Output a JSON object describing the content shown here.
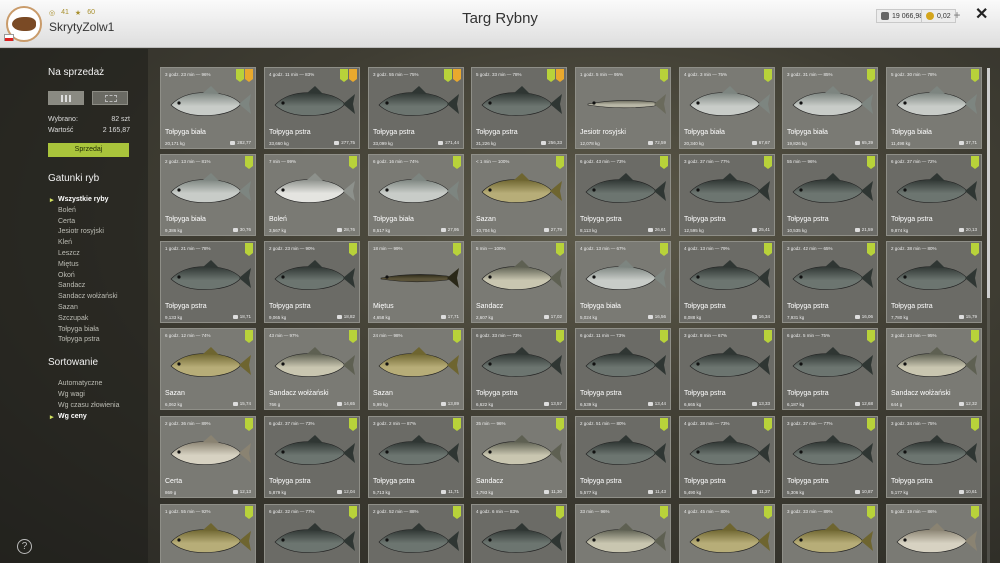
{
  "header": {
    "title": "Targ Rybny",
    "username": "SkrytyZolw1",
    "stat_a": "41",
    "stat_b": "60",
    "silver": "19 066,98",
    "gold": "0,02",
    "plus": "+",
    "close": "✕"
  },
  "sidebar": {
    "for_sale": "Na sprzedaż",
    "selected_label": "Wybrano:",
    "selected_value": "82 szt",
    "value_label": "Wartość",
    "value_value": "2 165,87",
    "sell": "Sprzedaj",
    "species_title": "Gatunki ryb",
    "species": [
      "Wszystkie ryby",
      "Boleń",
      "Certa",
      "Jesiotr rosyjski",
      "Kleń",
      "Leszcz",
      "Miętus",
      "Okoń",
      "Sandacz",
      "Sandacz wołżański",
      "Sazan",
      "Szczupak",
      "Tołpyga biała",
      "Tołpyga pstra"
    ],
    "sort_title": "Sortowanie",
    "sort": [
      "Automatyczne",
      "Wg wagi",
      "Wg czasu złowienia",
      "Wg ceny"
    ],
    "help": "?"
  },
  "colors": {
    "accent": "#a9c43b",
    "badge_green": "#b8d23a",
    "badge_orange": "#e9a92d",
    "gold": "#d4a51c"
  },
  "cards": [
    {
      "time": "3 godz. 23 min — 96%",
      "name": "Tołpyga biała",
      "weight": "20,171 kg",
      "price": "282,77",
      "badges": [
        "green",
        "orange"
      ],
      "fish": "carp-silver"
    },
    {
      "time": "4 godz. 11 min — 83%",
      "name": "Tołpyga pstra",
      "weight": "33,660 kg",
      "price": "277,75",
      "badges": [
        "green",
        "orange"
      ],
      "fish": "carp-dark"
    },
    {
      "time": "3 godz. 55 min — 75%",
      "name": "Tołpyga pstra",
      "weight": "33,099 kg",
      "price": "271,44",
      "badges": [
        "green",
        "orange"
      ],
      "fish": "carp-dark"
    },
    {
      "time": "5 godz. 33 min — 78%",
      "name": "Tołpyga pstra",
      "weight": "31,226 kg",
      "price": "256,33",
      "badges": [
        "green",
        "orange"
      ],
      "fish": "carp-dark"
    },
    {
      "time": "1 godz. 5 min — 95%",
      "name": "Jesiotr rosyjski",
      "weight": "12,078 kg",
      "price": "72,59",
      "badges": [
        "green"
      ],
      "fish": "sturgeon"
    },
    {
      "time": "4 godz. 3 min — 75%",
      "name": "Tołpyga biała",
      "weight": "20,340 kg",
      "price": "67,67",
      "badges": [
        "green"
      ],
      "fish": "carp-silver"
    },
    {
      "time": "3 godz. 31 min — 85%",
      "name": "Tołpyga biała",
      "weight": "19,826 kg",
      "price": "65,39",
      "badges": [
        "green"
      ],
      "fish": "carp-silver"
    },
    {
      "time": "5 godz. 30 min — 78%",
      "name": "Tołpyga biała",
      "weight": "11,498 kg",
      "price": "37,71",
      "badges": [
        "green"
      ],
      "fish": "carp-silver"
    },
    {
      "time": "2 godz. 13 min — 81%",
      "name": "Tołpyga biała",
      "weight": "9,386 kg",
      "price": "30,76",
      "badges": [
        "green"
      ],
      "fish": "carp-silver"
    },
    {
      "time": "7 min — 99%",
      "name": "Boleń",
      "weight": "3,567 kg",
      "price": "28,76",
      "badges": [
        "green"
      ],
      "fish": "asp"
    },
    {
      "time": "6 godz. 16 min — 74%",
      "name": "Tołpyga biała",
      "weight": "8,517 kg",
      "price": "27,95",
      "badges": [
        "green"
      ],
      "fish": "carp-silver"
    },
    {
      "time": "< 1 min — 100%",
      "name": "Sazan",
      "weight": "10,704 kg",
      "price": "27,79",
      "badges": [
        "green"
      ],
      "fish": "sazan"
    },
    {
      "time": "6 godz. 43 min — 73%",
      "name": "Tołpyga pstra",
      "weight": "8,113 kg",
      "price": "26,61",
      "badges": [
        "green"
      ],
      "fish": "carp-dark"
    },
    {
      "time": "3 godz. 37 min — 77%",
      "name": "Tołpyga pstra",
      "weight": "12,595 kg",
      "price": "25,41",
      "badges": [
        "green"
      ],
      "fish": "carp-dark"
    },
    {
      "time": "55 min — 96%",
      "name": "Tołpyga pstra",
      "weight": "10,535 kg",
      "price": "21,59",
      "badges": [
        "green"
      ],
      "fish": "carp-dark"
    },
    {
      "time": "6 godz. 37 min — 72%",
      "name": "Tołpyga pstra",
      "weight": "9,874 kg",
      "price": "20,13",
      "badges": [
        "green"
      ],
      "fish": "carp-dark"
    },
    {
      "time": "1 godz. 21 min — 78%",
      "name": "Tołpyga pstra",
      "weight": "9,133 kg",
      "price": "18,71",
      "badges": [
        "green"
      ],
      "fish": "carp-dark"
    },
    {
      "time": "2 godz. 23 min — 90%",
      "name": "Tołpyga pstra",
      "weight": "9,065 kg",
      "price": "18,82",
      "badges": [
        "green"
      ],
      "fish": "carp-dark"
    },
    {
      "time": "18 min — 99%",
      "name": "Miętus",
      "weight": "4,658 kg",
      "price": "17,71",
      "badges": [
        "green"
      ],
      "fish": "burbot"
    },
    {
      "time": "5 min — 100%",
      "name": "Sandacz",
      "weight": "2,607 kg",
      "price": "17,02",
      "badges": [
        "green"
      ],
      "fish": "zander"
    },
    {
      "time": "4 godz. 13 min — 67%",
      "name": "Tołpyga biała",
      "weight": "5,024 kg",
      "price": "16,56",
      "badges": [
        "green"
      ],
      "fish": "carp-silver"
    },
    {
      "time": "4 godz. 13 min — 79%",
      "name": "Tołpyga pstra",
      "weight": "8,088 kg",
      "price": "16,34",
      "badges": [
        "green"
      ],
      "fish": "carp-dark"
    },
    {
      "time": "3 godz. 42 min — 65%",
      "name": "Tołpyga pstra",
      "weight": "7,931 kg",
      "price": "16,06",
      "badges": [
        "green"
      ],
      "fish": "carp-dark"
    },
    {
      "time": "2 godz. 38 min — 80%",
      "name": "Tołpyga pstra",
      "weight": "7,780 kg",
      "price": "15,79",
      "badges": [
        "green"
      ],
      "fish": "carp-dark"
    },
    {
      "time": "6 godz. 12 min — 74%",
      "name": "Sazan",
      "weight": "6,062 kg",
      "price": "15,74",
      "badges": [
        "green"
      ],
      "fish": "sazan"
    },
    {
      "time": "43 min — 97%",
      "name": "Sandacz wołżański",
      "weight": "766 g",
      "price": "14,65",
      "badges": [
        "green"
      ],
      "fish": "zander"
    },
    {
      "time": "24 min — 98%",
      "name": "Sazan",
      "weight": "5,99 kg",
      "price": "13,89",
      "badges": [
        "green"
      ],
      "fish": "sazan"
    },
    {
      "time": "6 godz. 33 min — 73%",
      "name": "Tołpyga pstra",
      "weight": "6,622 kg",
      "price": "13,57",
      "badges": [
        "green"
      ],
      "fish": "carp-dark"
    },
    {
      "time": "6 godz. 11 min — 73%",
      "name": "Tołpyga pstra",
      "weight": "6,539 kg",
      "price": "13,44",
      "badges": [
        "green"
      ],
      "fish": "carp-dark"
    },
    {
      "time": "3 godz. 8 min — 67%",
      "name": "Tołpyga pstra",
      "weight": "6,665 kg",
      "price": "13,33",
      "badges": [
        "green"
      ],
      "fish": "carp-dark"
    },
    {
      "time": "6 godz. 5 min — 75%",
      "name": "Tołpyga pstra",
      "weight": "6,187 kg",
      "price": "12,68",
      "badges": [
        "green"
      ],
      "fish": "carp-dark"
    },
    {
      "time": "3 godz. 13 min — 95%",
      "name": "Sandacz wołżański",
      "weight": "644 g",
      "price": "12,32",
      "badges": [
        "green"
      ],
      "fish": "zander"
    },
    {
      "time": "2 godz. 36 min — 89%",
      "name": "Certa",
      "weight": "869 g",
      "price": "12,13",
      "badges": [
        "green"
      ],
      "fish": "bream"
    },
    {
      "time": "6 godz. 37 min — 73%",
      "name": "Tołpyga pstra",
      "weight": "5,879 kg",
      "price": "12,04",
      "badges": [
        "green"
      ],
      "fish": "carp-dark"
    },
    {
      "time": "3 godz. 2 min — 87%",
      "name": "Tołpyga pstra",
      "weight": "5,713 kg",
      "price": "11,71",
      "badges": [
        "green"
      ],
      "fish": "carp-dark"
    },
    {
      "time": "35 min — 96%",
      "name": "Sandacz",
      "weight": "1,793 kg",
      "price": "11,30",
      "badges": [
        "green"
      ],
      "fish": "zander"
    },
    {
      "time": "2 godz. 51 min — 80%",
      "name": "Tołpyga pstra",
      "weight": "5,577 kg",
      "price": "11,43",
      "badges": [
        "green"
      ],
      "fish": "carp-dark"
    },
    {
      "time": "4 godz. 38 min — 73%",
      "name": "Tołpyga pstra",
      "weight": "5,490 kg",
      "price": "11,27",
      "badges": [
        "green"
      ],
      "fish": "carp-dark"
    },
    {
      "time": "3 godz. 37 min — 77%",
      "name": "Tołpyga pstra",
      "weight": "5,306 kg",
      "price": "10,87",
      "badges": [
        "green"
      ],
      "fish": "carp-dark"
    },
    {
      "time": "3 godz. 34 min — 75%",
      "name": "Tołpyga pstra",
      "weight": "5,177 kg",
      "price": "10,61",
      "badges": [
        "green"
      ],
      "fish": "carp-dark"
    },
    {
      "time": "1 godz. 55 min — 92%",
      "name": "",
      "weight": "",
      "price": "",
      "badges": [
        "green"
      ],
      "fish": "sazan"
    },
    {
      "time": "6 godz. 32 min — 77%",
      "name": "",
      "weight": "",
      "price": "",
      "badges": [
        "green"
      ],
      "fish": "carp-dark"
    },
    {
      "time": "2 godz. 52 min — 88%",
      "name": "",
      "weight": "",
      "price": "",
      "badges": [
        "green"
      ],
      "fish": "carp-dark"
    },
    {
      "time": "4 godz. 6 min — 83%",
      "name": "",
      "weight": "",
      "price": "",
      "badges": [
        "green"
      ],
      "fish": "carp-dark"
    },
    {
      "time": "33 min — 96%",
      "name": "",
      "weight": "",
      "price": "",
      "badges": [
        "green"
      ],
      "fish": "zander"
    },
    {
      "time": "4 godz. 45 min — 80%",
      "name": "",
      "weight": "",
      "price": "",
      "badges": [
        "green"
      ],
      "fish": "sazan"
    },
    {
      "time": "3 godz. 33 min — 89%",
      "name": "",
      "weight": "",
      "price": "",
      "badges": [
        "green"
      ],
      "fish": "sazan"
    },
    {
      "time": "5 godz. 19 min — 86%",
      "name": "",
      "weight": "",
      "price": "",
      "badges": [
        "green"
      ],
      "fish": "bream"
    }
  ]
}
